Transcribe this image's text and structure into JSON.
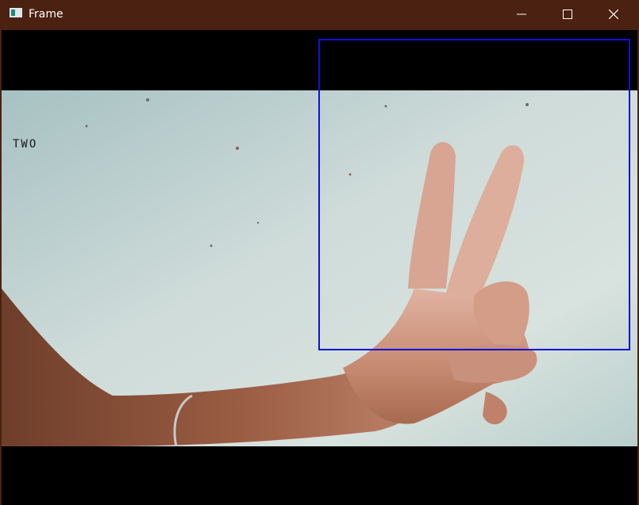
{
  "window": {
    "title": "Frame",
    "controls": {
      "minimize": "minimize-icon",
      "maximize": "maximize-icon",
      "close": "close-icon"
    }
  },
  "video": {
    "gesture_label": "TWO",
    "roi_color": "#1010d8",
    "label_color": "#1a1a1a"
  }
}
